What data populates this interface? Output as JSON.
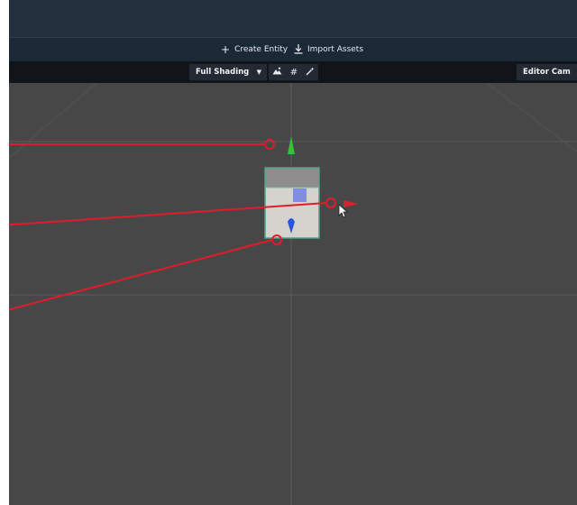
{
  "actions": {
    "create_entity": "Create Entity",
    "import_assets": "Import Assets"
  },
  "viewport_toolbar": {
    "shading_mode": "Full Shading",
    "camera": "Editor Cam"
  },
  "icons": {
    "create": "plus-icon",
    "import": "download-icon",
    "lighting": "mountain-icon",
    "grid": "grid-icon",
    "helpers": "wand-icon",
    "dropdown": "caret-down-icon"
  },
  "colors": {
    "title_bar": "#23303e",
    "action_bar": "#1b2836",
    "toolbar": "#111418",
    "viewport_bg": "#474747",
    "callout_red": "#e21b2b",
    "gizmo_y": "#36c13a",
    "gizmo_x": "#d9222d",
    "gizmo_z": "#2b55d8"
  }
}
